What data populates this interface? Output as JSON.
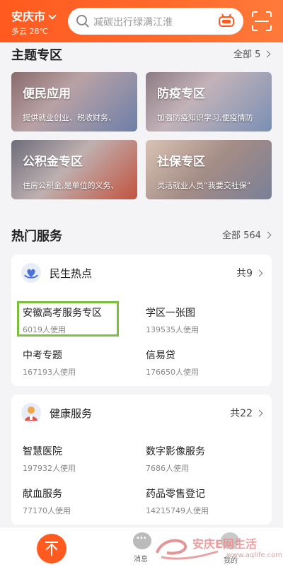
{
  "header": {
    "city": "安庆市",
    "weather": "多云 28℃",
    "search_placeholder": "减碳出行绿满江淮"
  },
  "theme": {
    "title": "主题专区",
    "more": "全部 5",
    "tiles": [
      {
        "title": "便民应用",
        "subtitle": "提供就业创业、税收财务、"
      },
      {
        "title": "防疫专区",
        "subtitle": "加强防疫知识学习,便疫情防"
      },
      {
        "title": "公积金专区",
        "subtitle": "住房公积金,是单位的义务、"
      },
      {
        "title": "社保专区",
        "subtitle": "灵活就业人员“我要交社保”"
      }
    ]
  },
  "hot": {
    "title": "热门服务",
    "more": "全部 564"
  },
  "cards": [
    {
      "name": "民生热点",
      "count": "共9",
      "items": [
        {
          "name": "安徽高考服务专区",
          "usage": "6019人使用"
        },
        {
          "name": "学区一张图",
          "usage": "139535人使用"
        },
        {
          "name": "中考专题",
          "usage": "167193人使用"
        },
        {
          "name": "信易贷",
          "usage": "176650人使用"
        }
      ]
    },
    {
      "name": "健康服务",
      "count": "共22",
      "items": [
        {
          "name": "智慧医院",
          "usage": "197932人使用"
        },
        {
          "name": "数字影像服务",
          "usage": "7686人使用"
        },
        {
          "name": "献血服务",
          "usage": "77170人使用"
        },
        {
          "name": "药品零售登记",
          "usage": "14215749人使用"
        }
      ]
    }
  ],
  "bottom": {
    "messages": "消息",
    "me": "我的"
  },
  "watermark": {
    "text": "安庆E网生活",
    "url": "www.aqlife.com"
  },
  "colors": {
    "accent": "#ff5a1f",
    "highlight": "#7fbf3f"
  }
}
